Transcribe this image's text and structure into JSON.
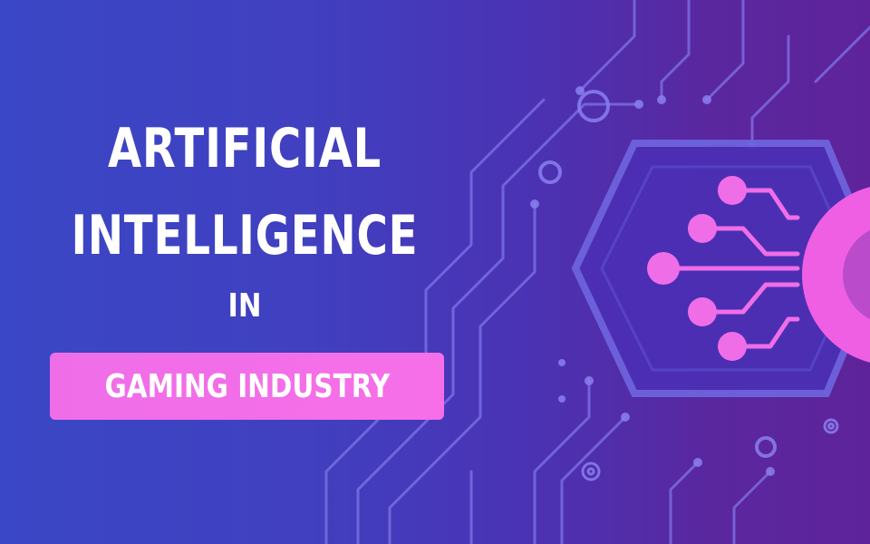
{
  "headline": {
    "line1": "ARTIFICIAL",
    "line2": "INTELLIGENCE",
    "line3": "IN"
  },
  "tag": {
    "label": "GAMING INDUSTRY"
  },
  "colors": {
    "background_start": "#3a47c6",
    "background_end": "#5e239a",
    "accent_pink": "#f06ee8",
    "circuit_line": "#7d72e6",
    "text": "#ffffff"
  },
  "icons": [
    "circuit-board-icon",
    "hexagon-chip-icon",
    "neural-connector-icon",
    "gear-icon"
  ]
}
